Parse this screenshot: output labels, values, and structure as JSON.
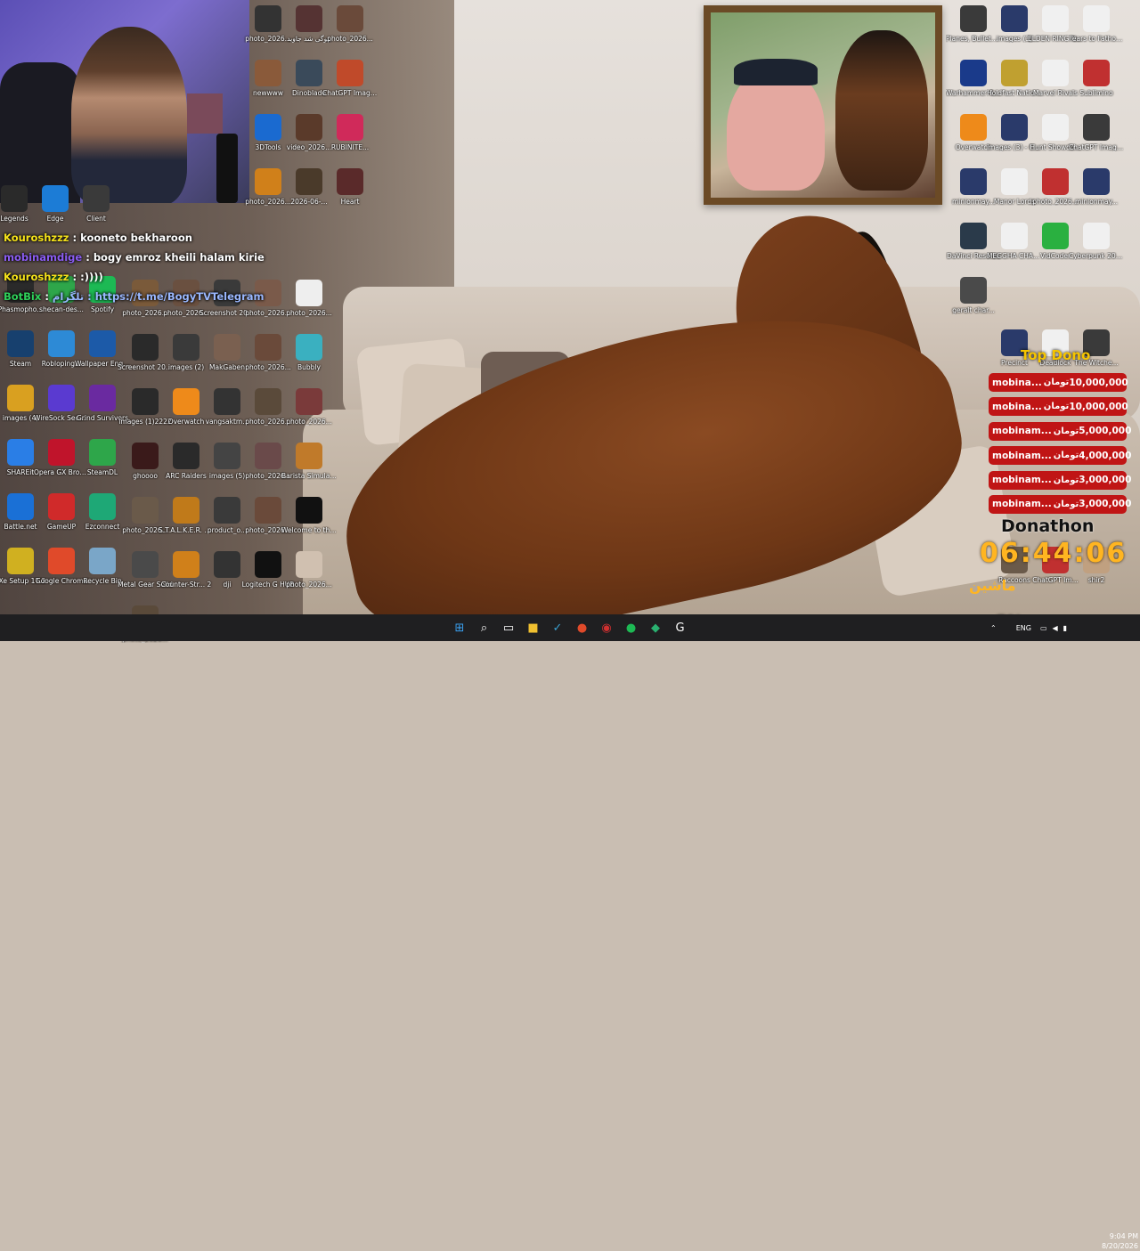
{
  "chat": [
    {
      "user": "Kouroshzzz",
      "message": "kooneto bekharoon",
      "color": "#f5e21a"
    },
    {
      "user": "mobinamdige",
      "message": "bogy emroz kheili halam kirie",
      "color": "#8a5cf2"
    },
    {
      "user": "Kouroshzzz",
      "message": ":))))",
      "color": "#f5e21a"
    },
    {
      "user": "BotBix",
      "message": "تلگرام : https://t.me/BogyTVTelegram",
      "color": "#2fd05a"
    }
  ],
  "donations": {
    "title": "Top Dono",
    "currency": "تومان",
    "rows": [
      {
        "name": "mobina...",
        "amount": "10,000,000"
      },
      {
        "name": "mobina...",
        "amount": "10,000,000"
      },
      {
        "name": "mobinam...",
        "amount": "5,000,000"
      },
      {
        "name": "mobinam...",
        "amount": "4,000,000"
      },
      {
        "name": "mobinam...",
        "amount": "3,000,000"
      },
      {
        "name": "mobinam...",
        "amount": "3,000,000"
      }
    ],
    "donathon_label": "Donathon",
    "timer": "06:44:06",
    "subtitle": "ماشین",
    "percent": "5%"
  },
  "desktop_left": [
    {
      "label": "Legends",
      "icon": "game-icon",
      "color": "#2a2a2a"
    },
    {
      "label": "Edge",
      "icon": "browser-icon",
      "color": "#1c7cd6"
    },
    {
      "label": "Client",
      "icon": "app-icon",
      "color": "#3a3a3a"
    },
    {
      "label": "Phasmopho...",
      "icon": "ghost-icon",
      "color": "#2a2a2a"
    },
    {
      "label": "shecan-des...",
      "icon": "app-icon",
      "color": "#2ea64a"
    },
    {
      "label": "Spotify",
      "icon": "music-icon",
      "color": "#1db954"
    },
    {
      "label": "Steam",
      "icon": "steam-icon",
      "color": "#17406e"
    },
    {
      "label": "Robloping...",
      "icon": "app-icon",
      "color": "#2d8ad6"
    },
    {
      "label": "Wallpaper Engine",
      "icon": "wallpaper-icon",
      "color": "#1c5aa8"
    },
    {
      "label": "images (4)",
      "icon": "image-icon",
      "color": "#d9a020"
    },
    {
      "label": "WireSock Secure ...",
      "icon": "vpn-icon",
      "color": "#5a3ad0"
    },
    {
      "label": "Grind Survivors",
      "icon": "game-icon",
      "color": "#6a2aa0"
    },
    {
      "label": "SHAREit",
      "icon": "share-icon",
      "color": "#2a7ee6"
    },
    {
      "label": "Opera GX Browser",
      "icon": "browser-icon",
      "color": "#c0142b"
    },
    {
      "label": "SteamDL",
      "icon": "download-icon",
      "color": "#2ea64a"
    },
    {
      "label": "Battle.net",
      "icon": "battlenet-icon",
      "color": "#1a70d6"
    },
    {
      "label": "GameUP",
      "icon": "game-icon",
      "color": "#d02a2a"
    },
    {
      "label": "Ezconnect",
      "icon": "connect-icon",
      "color": "#1ea876"
    },
    {
      "label": "sXe Setup 17.2",
      "icon": "setup-icon",
      "color": "#d0b020"
    },
    {
      "label": "Google Chrome",
      "icon": "chrome-icon",
      "color": "#e04a2a"
    },
    {
      "label": "Recycle Bin",
      "icon": "recycle-bin-icon",
      "color": "#7aa6c8"
    }
  ],
  "desktop_mid": [
    {
      "label": "photo_2026...",
      "icon": "image-icon",
      "color": "#333"
    },
    {
      "label": "بیوگی شد جاوید",
      "icon": "image-icon",
      "color": "#553333"
    },
    {
      "label": "photo_2026...",
      "icon": "image-icon",
      "color": "#6a4a3a"
    },
    {
      "label": "newwww",
      "icon": "image-icon",
      "color": "#8a5a3a"
    },
    {
      "label": "Dinoblade",
      "icon": "image-icon",
      "color": "#3a4a5a"
    },
    {
      "label": "ChatGPT Image Aug...",
      "icon": "image-icon",
      "color": "#c04a2a"
    },
    {
      "label": "3DTools",
      "icon": "app-icon",
      "color": "#1a6ad0"
    },
    {
      "label": "video_2026...",
      "icon": "video-icon",
      "color": "#5a3a2a"
    },
    {
      "label": "RUBINITE...",
      "icon": "app-icon",
      "color": "#d02a5a"
    },
    {
      "label": "photo_2026...",
      "icon": "image-icon",
      "color": "#d0801a"
    },
    {
      "label": "2026-06-...",
      "icon": "image-icon",
      "color": "#4a3a2a"
    },
    {
      "label": "Heart",
      "icon": "image-icon",
      "color": "#5a2a2a"
    },
    {
      "label": "photo_2026...",
      "icon": "image-icon",
      "color": "#7a5a3a"
    },
    {
      "label": "photo_2026...",
      "icon": "image-icon",
      "color": "#6a5040"
    },
    {
      "label": "Screenshot 2026-06-...",
      "icon": "image-icon",
      "color": "#3a3a3a"
    },
    {
      "label": "photo_2026...",
      "icon": "image-icon",
      "color": "#7a5a4a"
    },
    {
      "label": "photo_2026...",
      "icon": "image-icon",
      "color": "#eeeeee"
    },
    {
      "label": "Screenshot 2026-06-...",
      "icon": "image-icon",
      "color": "#2a2a2a"
    },
    {
      "label": "images (2)",
      "icon": "image-icon",
      "color": "#3a3a3a"
    },
    {
      "label": "MakGaben",
      "icon": "image-icon",
      "color": "#7a6050"
    },
    {
      "label": "photo_2026...",
      "icon": "image-icon",
      "color": "#6a4a3a"
    },
    {
      "label": "Bubbly",
      "icon": "app-icon",
      "color": "#3ab0c0"
    },
    {
      "label": "images (1)2222",
      "icon": "image-icon",
      "color": "#2a2a2a"
    },
    {
      "label": "Overwatch",
      "icon": "overwatch-icon",
      "color": "#ee8a1a"
    },
    {
      "label": "vangsaktm...",
      "icon": "app-icon",
      "color": "#333"
    },
    {
      "label": "photo_2026...",
      "icon": "image-icon",
      "color": "#5a4a3a"
    },
    {
      "label": "photo_2026...",
      "icon": "image-icon",
      "color": "#7a3a3a"
    },
    {
      "label": "ghoooo",
      "icon": "image-icon",
      "color": "#3a1a1a"
    },
    {
      "label": "ARC Raiders",
      "icon": "game-icon",
      "color": "#2a2a2a"
    },
    {
      "label": "images (5)",
      "icon": "image-icon",
      "color": "#444"
    },
    {
      "label": "photo_2026...",
      "icon": "image-icon",
      "color": "#6a4a4a"
    },
    {
      "label": "Barista Simulator",
      "icon": "game-icon",
      "color": "#c07a2a"
    },
    {
      "label": "photo_2026...",
      "icon": "image-icon",
      "color": "#6a5a4a"
    },
    {
      "label": "S.T.A.L.K.E.R. 2 Heart of...",
      "icon": "game-icon",
      "color": "#c07a1a"
    },
    {
      "label": "product_o...",
      "icon": "image-icon",
      "color": "#3a3a3a"
    },
    {
      "label": "photo_2026...",
      "icon": "image-icon",
      "color": "#6a4a3a"
    },
    {
      "label": "Welcome to the Game II",
      "icon": "game-icon",
      "color": "#111"
    },
    {
      "label": "Metal Gear Solid",
      "icon": "game-icon",
      "color": "#4a4a4a"
    },
    {
      "label": "Counter-Str... 2",
      "icon": "counter-strike-icon",
      "color": "#d0801a"
    },
    {
      "label": "dji",
      "icon": "app-icon",
      "color": "#333"
    },
    {
      "label": "Logitech G HUB",
      "icon": "logitech-icon",
      "color": "#111"
    },
    {
      "label": "photo_2026...",
      "icon": "image-icon",
      "color": "#d0c0b0"
    },
    {
      "label": "photo_2026...",
      "icon": "image-icon",
      "color": "#5a4a3a"
    }
  ],
  "desktop_right": [
    {
      "label": "Planes, Bullets an...",
      "icon": "game-icon",
      "color": "#3a3a3a"
    },
    {
      "label": "images (3)",
      "icon": "image-icon",
      "color": "#2a3a6a"
    },
    {
      "label": "ELDEN RING NIGHTREIGN",
      "icon": "file-icon",
      "color": "#f0f0f0"
    },
    {
      "label": "Fears to Fathom - Sc...",
      "icon": "file-icon",
      "color": "#f0f0f0"
    },
    {
      "label": "Warhammer 40,000 Spa...",
      "icon": "game-icon",
      "color": "#1a3a8a"
    },
    {
      "label": "Holdfast Nations ...",
      "icon": "game-icon",
      "color": "#c0a030"
    },
    {
      "label": "Marvel Rivals",
      "icon": "file-icon",
      "color": "#f0f0f0"
    },
    {
      "label": "Sublimino",
      "icon": "image-icon",
      "color": "#c03030"
    },
    {
      "label": "Overwatch",
      "icon": "overwatch-icon",
      "color": "#ee8a1a"
    },
    {
      "label": "images (3) - Copy",
      "icon": "image-icon",
      "color": "#2a3a6a"
    },
    {
      "label": "Hunt Showdo...",
      "icon": "file-icon",
      "color": "#f0f0f0"
    },
    {
      "label": "ChatGPT Image Jun...",
      "icon": "image-icon",
      "color": "#3a3a3a"
    },
    {
      "label": "minionmay...",
      "icon": "image-icon",
      "color": "#2a3a6a"
    },
    {
      "label": "Manor Lords",
      "icon": "file-icon",
      "color": "#f0f0f0"
    },
    {
      "label": "photo_2026...",
      "icon": "image-icon",
      "color": "#c03030"
    },
    {
      "label": "minionmay...",
      "icon": "image-icon",
      "color": "#2a3a6a"
    },
    {
      "label": "DaVinci Resolve",
      "icon": "davinci-icon",
      "color": "#2a3a4a"
    },
    {
      "label": "MEGGHA CHAMELEON",
      "icon": "file-icon",
      "color": "#f0f0f0"
    },
    {
      "label": "VidCoder",
      "icon": "video-icon",
      "color": "#2ab040"
    },
    {
      "label": "Cyberpunk 2077",
      "icon": "file-icon",
      "color": "#f0f0f0"
    },
    {
      "label": "geralt char...",
      "icon": "image-icon",
      "color": "#4a4a4a"
    },
    {
      "label": "Precinct",
      "icon": "game-icon",
      "color": "#2a3a6a"
    },
    {
      "label": "Deadlock",
      "icon": "file-icon",
      "color": "#f0f0f0"
    },
    {
      "label": "The Witche...",
      "icon": "image-icon",
      "color": "#3a3a3a"
    },
    {
      "label": "Raccoons",
      "icon": "image-icon",
      "color": "#6a5a4a"
    },
    {
      "label": "ChatGPT Im...",
      "icon": "image-icon",
      "color": "#c03030"
    },
    {
      "label": "shir2",
      "icon": "image-icon",
      "color": "#c0a080"
    }
  ],
  "taskbar": {
    "apps": [
      {
        "name": "start-button",
        "icon": "windows-icon",
        "glyph": "⊞",
        "color": "#3aa0f0"
      },
      {
        "name": "search-button",
        "icon": "search-icon",
        "glyph": "⌕",
        "color": "#ffffff"
      },
      {
        "name": "task-view-button",
        "icon": "task-view-icon",
        "glyph": "▭",
        "color": "#ffffff"
      },
      {
        "name": "file-explorer-button",
        "icon": "folder-icon",
        "glyph": "■",
        "color": "#f0c030"
      },
      {
        "name": "app-button-1",
        "icon": "app-icon",
        "glyph": "✓",
        "color": "#3aa0d0"
      },
      {
        "name": "chrome-button",
        "icon": "chrome-icon",
        "glyph": "●",
        "color": "#e04a2a"
      },
      {
        "name": "app-button-2",
        "icon": "app-icon",
        "glyph": "◉",
        "color": "#d03030"
      },
      {
        "name": "spotify-button",
        "icon": "music-icon",
        "glyph": "●",
        "color": "#1db954"
      },
      {
        "name": "app-button-3",
        "icon": "app-icon",
        "glyph": "◆",
        "color": "#2ab070"
      },
      {
        "name": "app-button-4",
        "icon": "app-icon",
        "glyph": "G",
        "color": "#ffffff"
      }
    ],
    "language": "ENG",
    "time": "9:04 PM",
    "date": "8/20/2026"
  }
}
